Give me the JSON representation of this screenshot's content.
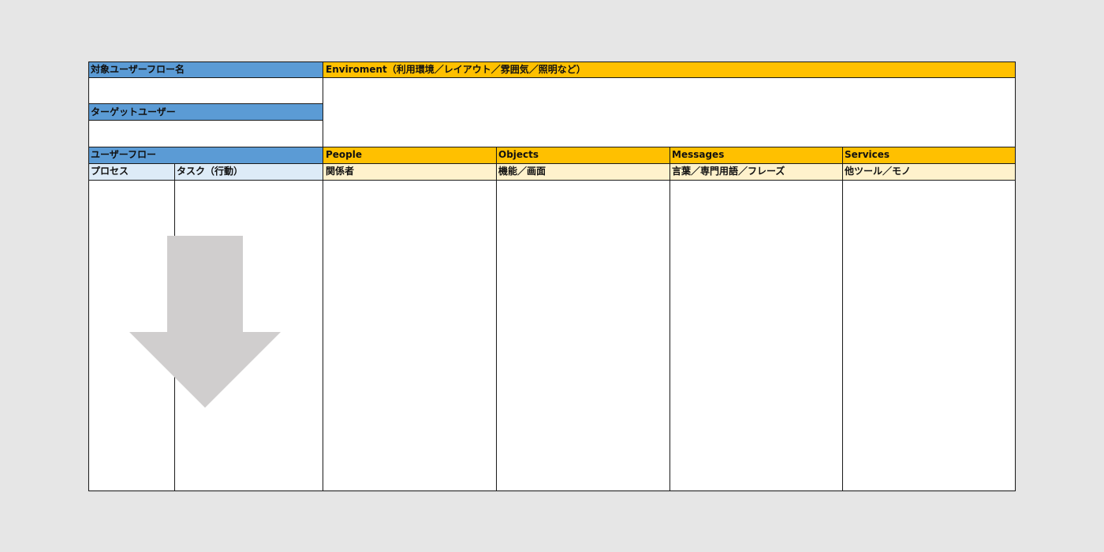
{
  "left_panel": {
    "target_flow_label": "対象ユーザーフロー名",
    "target_user_label": "ターゲットユーザー",
    "user_flow_label": "ユーザーフロー",
    "process_label": "プロセス",
    "task_label": "タスク（行動）"
  },
  "environment": {
    "label": "Enviroment（利用環境／レイアウト／雰囲気／照明など）"
  },
  "columns": [
    {
      "header": "People",
      "sub": "関係者"
    },
    {
      "header": "Objects",
      "sub": "機能／画面"
    },
    {
      "header": "Messages",
      "sub": "言葉／専門用語／フレーズ"
    },
    {
      "header": "Services",
      "sub": "他ツール／モノ"
    }
  ],
  "colors": {
    "blue": "#5b9bd5",
    "light_blue": "#ddebf7",
    "yellow": "#ffc000",
    "light_yellow": "#fff2cc",
    "arrow": "#d0cece"
  },
  "icons": {
    "flow_arrow": "down-arrow-icon"
  }
}
